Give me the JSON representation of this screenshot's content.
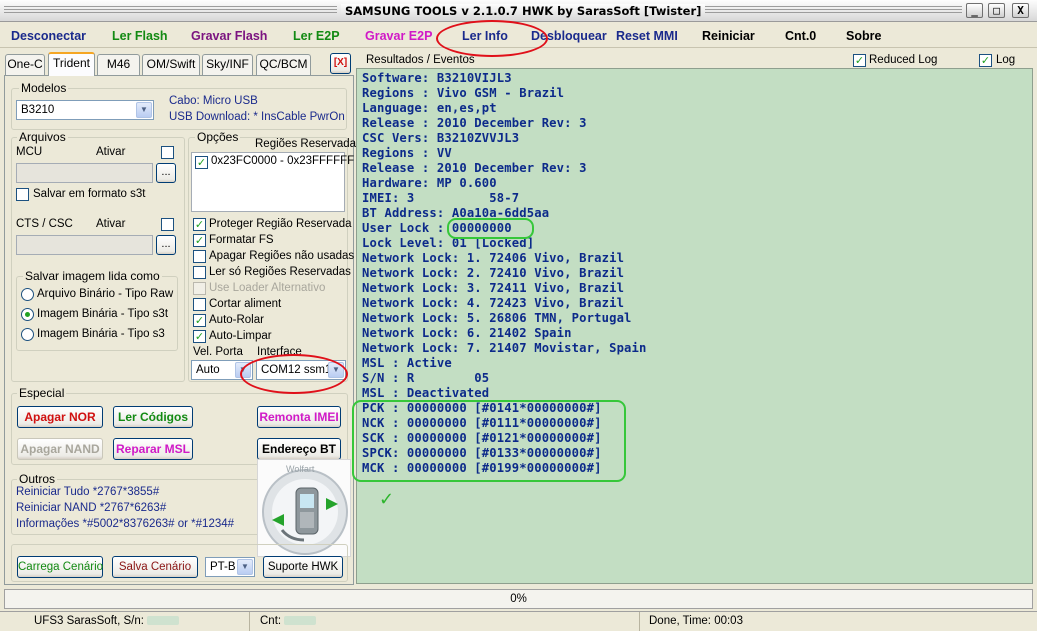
{
  "window": {
    "title": "SAMSUNG TOOLS v 2.1.0.7 HWK by SarasSoft  [Twister]",
    "minimize_glyph": "_",
    "maximize_glyph": "□",
    "close_glyph": "X"
  },
  "menu": [
    {
      "label": "Desconectar",
      "color": "#1a2a8c"
    },
    {
      "label": "Ler Flash",
      "color": "#138a13"
    },
    {
      "label": "Gravar Flash",
      "color": "#7b1480"
    },
    {
      "label": "Ler E2P",
      "color": "#138a13"
    },
    {
      "label": "Gravar E2P",
      "color": "#d019c7"
    },
    {
      "label": "Ler Info",
      "color": "#1a2a8c"
    },
    {
      "label": "Desbloquear",
      "color": "#1a2a8c"
    },
    {
      "label": "Reset MMI",
      "color": "#1a2a8c"
    },
    {
      "label": "Reiniciar",
      "color": "#000000"
    },
    {
      "label": "Cnt.0",
      "color": "#000000"
    },
    {
      "label": "Sobre",
      "color": "#000000"
    }
  ],
  "tabs": [
    {
      "label": "One-C"
    },
    {
      "label": "Trident"
    },
    {
      "label": "M46"
    },
    {
      "label": "OM/Swift"
    },
    {
      "label": "Sky/INF"
    },
    {
      "label": "QC/BCM"
    }
  ],
  "tab_close_glyph": "[X]",
  "modelos": {
    "legend": "Modelos",
    "selected": "B3210",
    "cable_label": "Cabo: Micro USB",
    "usb_label": "USB Download:  *  InsCable PwrOn"
  },
  "arquivos": {
    "legend": "Arquivos",
    "mcu_label": "MCU",
    "mcu_ativar": "Ativar",
    "browse_glyph": "...",
    "save_s3t_label": "Salvar em formato s3t",
    "cts_label": "CTS / CSC",
    "cts_ativar": "Ativar",
    "save_image_legend": "Salvar imagem lida como",
    "radios": [
      {
        "label": "Arquivo Binário - Tipo Raw",
        "selected": false
      },
      {
        "label": "Imagem Binária - Tipo s3t",
        "selected": true
      },
      {
        "label": "Imagem Binária - Tipo s3",
        "selected": false
      }
    ]
  },
  "opcoes": {
    "legend": "Opções",
    "regions_label": "Regiões Reservadas",
    "region_item": "0x23FC0000 - 0x23FFFFFF",
    "checks": [
      {
        "label": "Proteger Região Reservada",
        "checked": true,
        "disabled": false
      },
      {
        "label": "Formatar FS",
        "checked": true,
        "disabled": false
      },
      {
        "label": "Apagar Regiões não usadas",
        "checked": false,
        "disabled": false
      },
      {
        "label": "Ler só Regiões Reservadas",
        "checked": false,
        "disabled": false
      },
      {
        "label": "Use Loader Alternativo",
        "checked": false,
        "disabled": true
      },
      {
        "label": "Cortar aliment",
        "checked": false,
        "disabled": false
      },
      {
        "label": "Auto-Rolar",
        "checked": true,
        "disabled": false
      },
      {
        "label": "Auto-Limpar",
        "checked": true,
        "disabled": false
      }
    ],
    "vel_porta_label": "Vel. Porta",
    "vel_porta_value": "Auto",
    "interface_label": "Interface",
    "interface_value": "COM12 ssm1"
  },
  "especial": {
    "legend": "Especial",
    "apagar_nor": "Apagar NOR",
    "ler_codigos": "Ler Códigos",
    "remonta_imei": "Remonta IMEI",
    "apagar_nand": "Apagar NAND",
    "reparar_msl": "Reparar MSL",
    "endereco_bt": "Endereço BT",
    "watermark": "Wolfart"
  },
  "outros": {
    "legend": "Outros",
    "lines": [
      "Reiniciar Tudo  *2767*3855#",
      "Reiniciar NAND  *2767*6263#",
      "Informações  *#5002*8376263#  or *#1234#"
    ]
  },
  "bottom_buttons": {
    "carrega": "Carrega Cenário",
    "salva": "Salva Cenário",
    "lang": "PT-B",
    "suporte": "Suporte HWK"
  },
  "results": {
    "header": "Resultados / Eventos",
    "reduced_log_label": "Reduced Log",
    "log_label": "Log",
    "lines": [
      "Software: B3210VIJL3",
      "Regions : Vivo GSM - Brazil",
      "Language: en,es,pt",
      "Release : 2010 December Rev: 3",
      "CSC Vers: B3210ZVVJL3",
      "Regions : VV",
      "Release : 2010 December Rev: 3",
      "Hardware: MP 0.600",
      "IMEI: 3          58-7",
      "BT Address: A0a10a-6dd5aa",
      "User Lock : 00000000",
      "Lock Level: 01 [Locked]",
      "Network Lock: 1. 72406 Vivo, Brazil",
      "Network Lock: 2. 72410 Vivo, Brazil",
      "Network Lock: 3. 72411 Vivo, Brazil",
      "Network Lock: 4. 72423 Vivo, Brazil",
      "Network Lock: 5. 26806 TMN, Portugal",
      "Network Lock: 6. 21402 Spain",
      "Network Lock: 7. 21407 Movistar, Spain",
      "MSL : Active",
      "S/N : R        05",
      "MSL : Deactivated",
      "PCK : 00000000 [#0141*00000000#]",
      "NCK : 00000000 [#0111*00000000#]",
      "SCK : 00000000 [#0121*00000000#]",
      "SPCK: 00000000 [#0133*00000000#]",
      "MCK : 00000000 [#0199*00000000#]"
    ],
    "done_glyph": "✓"
  },
  "progress": {
    "text": "0%",
    "percent": 0
  },
  "status": {
    "serial": "UFS3 SarasSoft, S/n:",
    "cnt": "Cnt:",
    "done": "Done, Time: 00:03"
  }
}
